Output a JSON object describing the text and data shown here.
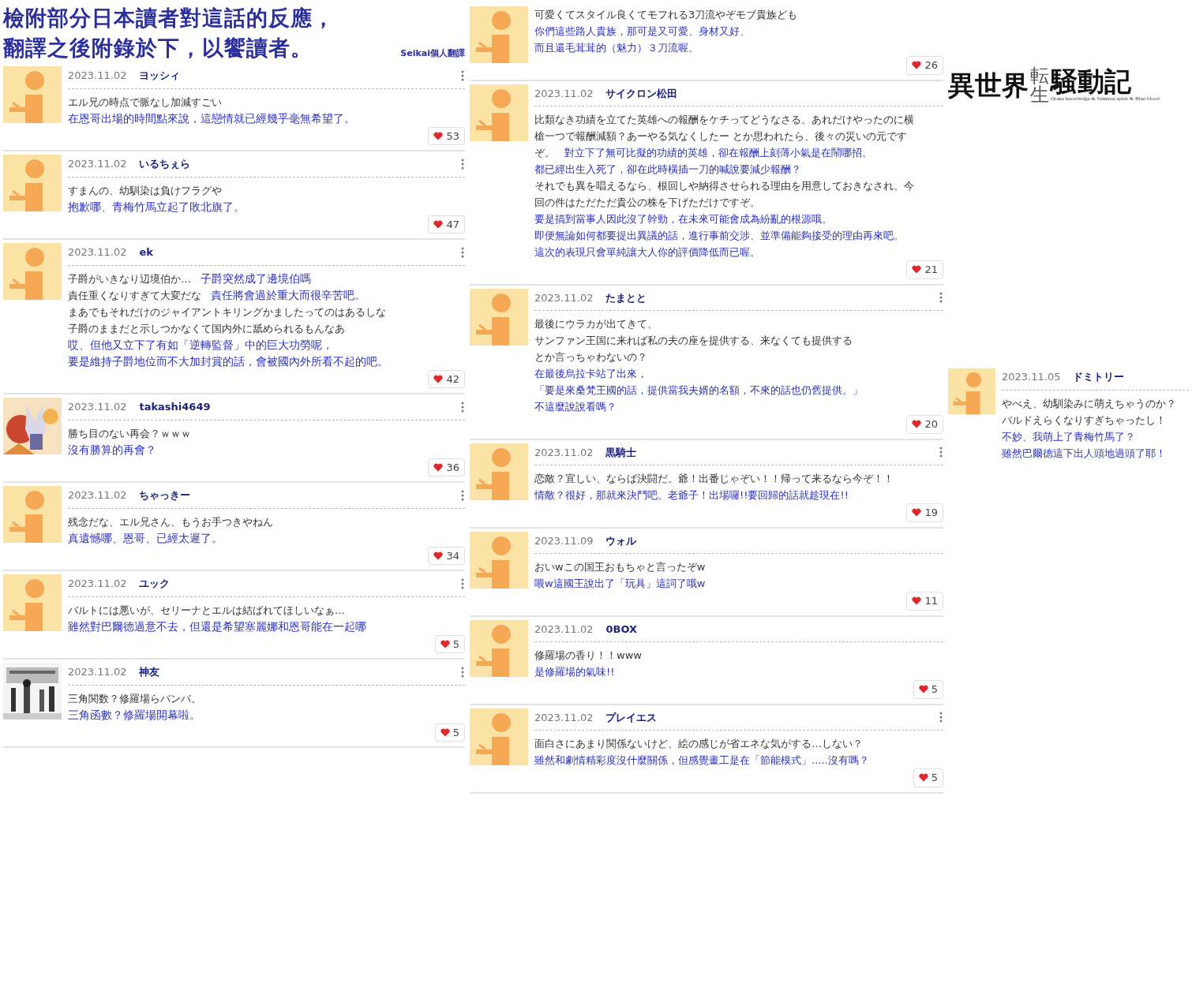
{
  "heading": {
    "lines": [
      "檢附部分日本讀者對這話的反應，",
      "翻譯之後附錄於下，以饗讀者。"
    ],
    "credit": "Seikai個人翻譯"
  },
  "logo": {
    "left": "異世界",
    "top": "転",
    "bottom": "生",
    "right": "騒動記",
    "subtitle": "Otaku knowledge & Samurai spirit & Blue blood"
  },
  "columns": [
    {
      "comments": [
        {
          "avatar": {
            "kind": "default"
          },
          "date": "2023.11.02",
          "user": "ヨッシィ",
          "menu": true,
          "lines": [
            {
              "ja": "エル兄の時点で脈なし加減すごい"
            },
            {
              "zh": "在恩哥出場的時間點來說，這戀情就已經幾乎毫無希望了。"
            }
          ],
          "likes": "53"
        },
        {
          "avatar": {
            "kind": "default"
          },
          "date": "2023.11.02",
          "user": "いるちぇら",
          "menu": true,
          "lines": [
            {
              "ja": "すまんの、幼馴染は負けフラグや"
            },
            {
              "zh": "抱歉哪、青梅竹馬立起了敗北旗了。"
            }
          ],
          "likes": "47"
        },
        {
          "avatar": {
            "kind": "default"
          },
          "date": "2023.11.02",
          "user": "ek",
          "menu": true,
          "lines": [
            {
              "ja": "子爵がいきなり辺境伯か…",
              "zh": "子爵突然成了邊境伯嗎"
            },
            {
              "ja": "責任重くなりすぎて大変だな",
              "zh": "責任將會過於重大而很辛苦吧。"
            },
            {
              "ja": "まあでもそれだけのジャイアントキリングかましたってのはあるしな"
            },
            {
              "ja": "子爵のままだと示しつかなくて国内外に舐められるもんなあ"
            },
            {
              "zh": "哎、但他又立下了有如「逆轉監督」中的巨大功勞呢，"
            },
            {
              "zh": "要是維持子爵地位而不大加封賞的話，會被國內外所看不起的吧。"
            }
          ],
          "likes": "42"
        },
        {
          "avatar": {
            "kind": "picture"
          },
          "date": "2023.11.02",
          "user": "takashi4649",
          "menu": true,
          "lines": [
            {
              "ja": "勝ち目のない再会？ｗｗｗ"
            },
            {
              "zh": "沒有勝算的再會？"
            }
          ],
          "likes": "36"
        },
        {
          "avatar": {
            "kind": "default"
          },
          "date": "2023.11.02",
          "user": "ちゃっきー",
          "menu": true,
          "lines": [
            {
              "ja": "残念だな、エル兄さん、もうお手つきやねん"
            },
            {
              "zh": "真遺憾哪、恩哥、已經太遲了。"
            }
          ],
          "likes": "34"
        },
        {
          "avatar": {
            "kind": "default"
          },
          "date": "2023.11.02",
          "user": "ユック",
          "menu": true,
          "lines": [
            {
              "ja": "バルトには悪いが、セリーナとエルは結ばれてほしいなぁ…"
            },
            {
              "zh": "雖然對巴爾德過意不去，但還是希望塞麗娜和恩哥能在一起哪"
            }
          ],
          "likes": "5"
        },
        {
          "avatar": {
            "kind": "picture"
          },
          "date": "2023.11.02",
          "user": "神友",
          "menu": true,
          "lines": [
            {
              "ja": "三角関数？修羅場らバンバ。"
            },
            {
              "zh": "三角函數？修羅場開幕啦。"
            }
          ],
          "likes": "5"
        }
      ]
    },
    {
      "comments": [
        {
          "avatar": {
            "kind": "default"
          },
          "menu": false,
          "lines": [
            {
              "ja": "可愛くてスタイル良くてモフれる3刀流やぞモブ貴族ども"
            },
            {
              "zh": "你們這些路人貴族，那可是又可愛、身材又好、"
            },
            {
              "zh": "而且還毛茸茸的（魅力）３刀流喔。"
            }
          ],
          "likes": "26"
        },
        {
          "avatar": {
            "kind": "default"
          },
          "date": "2023.11.02",
          "user": "サイクロン松田",
          "menu": false,
          "lines": [
            {
              "ja": "比類なき功績を立てた英雄への報酬をケチってどうなさる。あれだけやったのに横"
            },
            {
              "ja": "槍一つで報酬減額？あーやる気なくしたー とか思われたら、後々の災いの元です"
            },
            {
              "ja": "ぞ。",
              "zh": "對立下了無可比擬的功績的英雄，卻在報酬上刻薄小氣是在鬧哪招。"
            },
            {
              "zh": "都已經出生入死了，卻在此時橫插一刀的喊說要減少報酬？"
            },
            {
              "ja": "それでも異を唱えるなら、根回しや納得させられる理由を用意しておきなされ。今"
            },
            {
              "ja": "回の件はただただ貴公の株を下げただけですぞ。"
            },
            {
              "zh": "要是搞到當事人因此沒了幹勁，在未來可能會成為紛亂的根源哦。"
            },
            {
              "zh": "即便無論如何都要提出異議的話，進行事前交涉、並準備能夠接受的理由再來吧。"
            },
            {
              "zh": "這次的表現只會單純讓大人你的評價降低而已喔。"
            }
          ],
          "likes": "21"
        },
        {
          "avatar": {
            "kind": "default"
          },
          "date": "2023.11.02",
          "user": "たまとと",
          "menu": true,
          "lines": [
            {
              "ja": "最後にウラカが出てきて、"
            },
            {
              "ja": "サンファン王国に来れば私の夫の座を提供する、来なくても提供する"
            },
            {
              "ja": "とか言っちゃわないの？"
            },
            {
              "zh": "在最後烏拉卡站了出來，"
            },
            {
              "zh": "「要是來桑梵王國的話，提供當我夫婿的名額，不來的話也仍舊提供。」"
            },
            {
              "zh": "不這麼說說看嗎？"
            }
          ],
          "likes": "20"
        },
        {
          "avatar": {
            "kind": "default"
          },
          "date": "2023.11.02",
          "user": "黒騎士",
          "menu": true,
          "lines": [
            {
              "ja": "恋敵？宜しい、ならば決闘だ。爺！出番じゃぞい！！帰って来るなら今ぞ！！"
            },
            {
              "zh": "情敵？很好，那就來決鬥吧。老爺子！出場囉!!要回歸的話就趁現在!!"
            }
          ],
          "likes": "19"
        },
        {
          "avatar": {
            "kind": "default"
          },
          "date": "2023.11.09",
          "user": "ウォル",
          "menu": false,
          "lines": [
            {
              "ja": "おいwこの国王おもちゃと言ったぞw"
            },
            {
              "zh": "喂w這國王說出了「玩具」這詞了哦w"
            }
          ],
          "likes": "11"
        },
        {
          "avatar": {
            "kind": "default"
          },
          "date": "2023.11.02",
          "user": "0BOX",
          "menu": false,
          "lines": [
            {
              "ja": "修羅場の香り！！www"
            },
            {
              "zh": "是修羅場的氣味!!"
            }
          ],
          "likes": "5"
        },
        {
          "avatar": {
            "kind": "default"
          },
          "date": "2023.11.02",
          "user": "プレイエス",
          "menu": true,
          "lines": [
            {
              "ja": "面白さにあまり関係ないけど、絵の感じが省エネな気がする…しない？"
            },
            {
              "zh": "雖然和劇情精彩度沒什麼關係，但感覺畫工是在「節能模式」.....沒有嗎？"
            }
          ],
          "likes": "5"
        }
      ]
    },
    {
      "comments": [
        {
          "avatar": {
            "kind": "default"
          },
          "date": "2023.11.05",
          "user": "ドミトリー",
          "menu": false,
          "lines": [
            {
              "ja": "やべえ、幼馴染みに萌えちゃうのか？"
            },
            {
              "ja": "バルドえらくなりすぎちゃったし！"
            },
            {
              "zh": "不妙、我萌上了青梅竹馬了？"
            },
            {
              "zh": "雖然巴爾德這下出人頭地過頭了耶！"
            }
          ]
        }
      ]
    }
  ]
}
